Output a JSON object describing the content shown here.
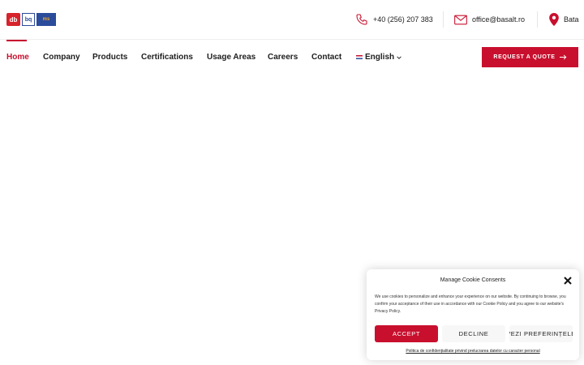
{
  "header": {
    "logos": [
      "db",
      "bq",
      "ms"
    ],
    "contacts": {
      "phone": {
        "icon": "phone-icon",
        "text": "+40 (256) 207 383"
      },
      "email": {
        "icon": "mail-icon",
        "text": "office@basalt.ro"
      },
      "location": {
        "icon": "location-pin-icon",
        "text": "Bata"
      }
    }
  },
  "nav": {
    "items": [
      {
        "label": "Home",
        "active": true
      },
      {
        "label": "Company"
      },
      {
        "label": "Products"
      },
      {
        "label": "Certifications"
      },
      {
        "label": "Usage Areas"
      },
      {
        "label": "Careers"
      },
      {
        "label": "Contact"
      }
    ],
    "language": {
      "label": "English",
      "icon": "chevron-down-icon"
    },
    "quote_button": {
      "label": "REQUEST A QUOTE",
      "icon": "arrow-right-icon"
    }
  },
  "cookie": {
    "title": "Manage Cookie Consents",
    "text": "We use cookies to personalize and enhance your experience on our website. By continuing to browse, you confirm your acceptance of their use in accordance with our Cookie Policy and you agree to our website's Privacy Policy.",
    "accept": "ACCEPT",
    "decline": "DECLINE",
    "preferences": "VEZI PREFERINȚELE",
    "link": "Politica de confidențialitate privind prelucrarea datelor cu caracter personal"
  },
  "colors": {
    "accent": "#c8102e",
    "text": "#1d1d1d"
  }
}
